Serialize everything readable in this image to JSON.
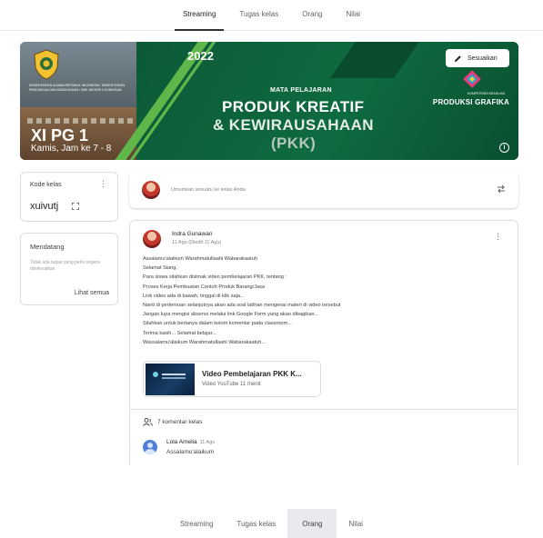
{
  "top_tabs": {
    "streaming": "Streaming",
    "tugas_kelas": "Tugas kelas",
    "orang": "Orang",
    "nilai": "Nilai"
  },
  "banner": {
    "year": "2022",
    "mata_pelajaran": "MATA PELAJARAN",
    "subject_line1": "PRODUK KREATIF",
    "subject_line2": "& KEWIRAUSAHAAN",
    "subject_line3": "(PKK)",
    "class_name": "XI PG 1",
    "schedule": "Kamis, Jam ke 7 - 8",
    "edit_label": "Sesuaikan",
    "competency_small": "KOMPETENSI KEAHLIAN",
    "competency_name": "PRODUKSI GRAFIKA",
    "school_text": "KEMENTERIAN AGAMA REPUBLIK INDONESIA / KEMENTERIAN PENDIDIKAN DAN KEBUDAYAAN / SMK NEGERI 3 KUNINGAN"
  },
  "class_code": {
    "label": "Kode kelas",
    "code": "xuivutj"
  },
  "upcoming": {
    "title": "Mendatang",
    "none": "Tidak ada tugas yang perlu segera diselesaikan",
    "view_all": "Lihat semua"
  },
  "announce": {
    "placeholder": "Umumkan sesuatu ke kelas Anda"
  },
  "post": {
    "author": "Indra Gunawan",
    "date": "11 Agu (Diedit 11 Agu)",
    "lines": [
      "Assalamu'alaikum Warahmatullaahi Wabarakaatuh",
      "Selamat Siang.",
      "Para siswa silahkan disimak video pembelajaran PKK, tentang :",
      "Proses Kerja Pembuatan Contoh Produk Barang/Jasa",
      "Link video ada di bawah, tinggal di klik saja...",
      "Nanti di pertemuan selanjutnya akan ada soal latihan mengenai materi di video tersebut",
      "Jangan lupa mengisi absensi melalui link Google Form yang akan dibagikan...",
      "Silahkan untuk bertanya dalam kolom komentar pada classroom...",
      "Terima kasih... Selamat belajar...",
      "Wassalamu'alaikum Warahmatullaahi Wabarakaatuh..."
    ],
    "attachment_title": "Video Pembelajaran PKK K...",
    "attachment_sub": "Video YouTube  11 menit",
    "comments_count": "7 komentar kelas",
    "comment_author": "Lola Amelia",
    "comment_date": "11 Agu",
    "comment_text": "Assalamu'alaikum"
  },
  "bottom_tabs": {
    "streaming": "Streaming",
    "tugas_kelas": "Tugas kelas",
    "orang": "Orang",
    "nilai": "Nilai"
  },
  "colors": {
    "banner_green": "#0e6b40",
    "banner_accent": "#5fb649"
  }
}
